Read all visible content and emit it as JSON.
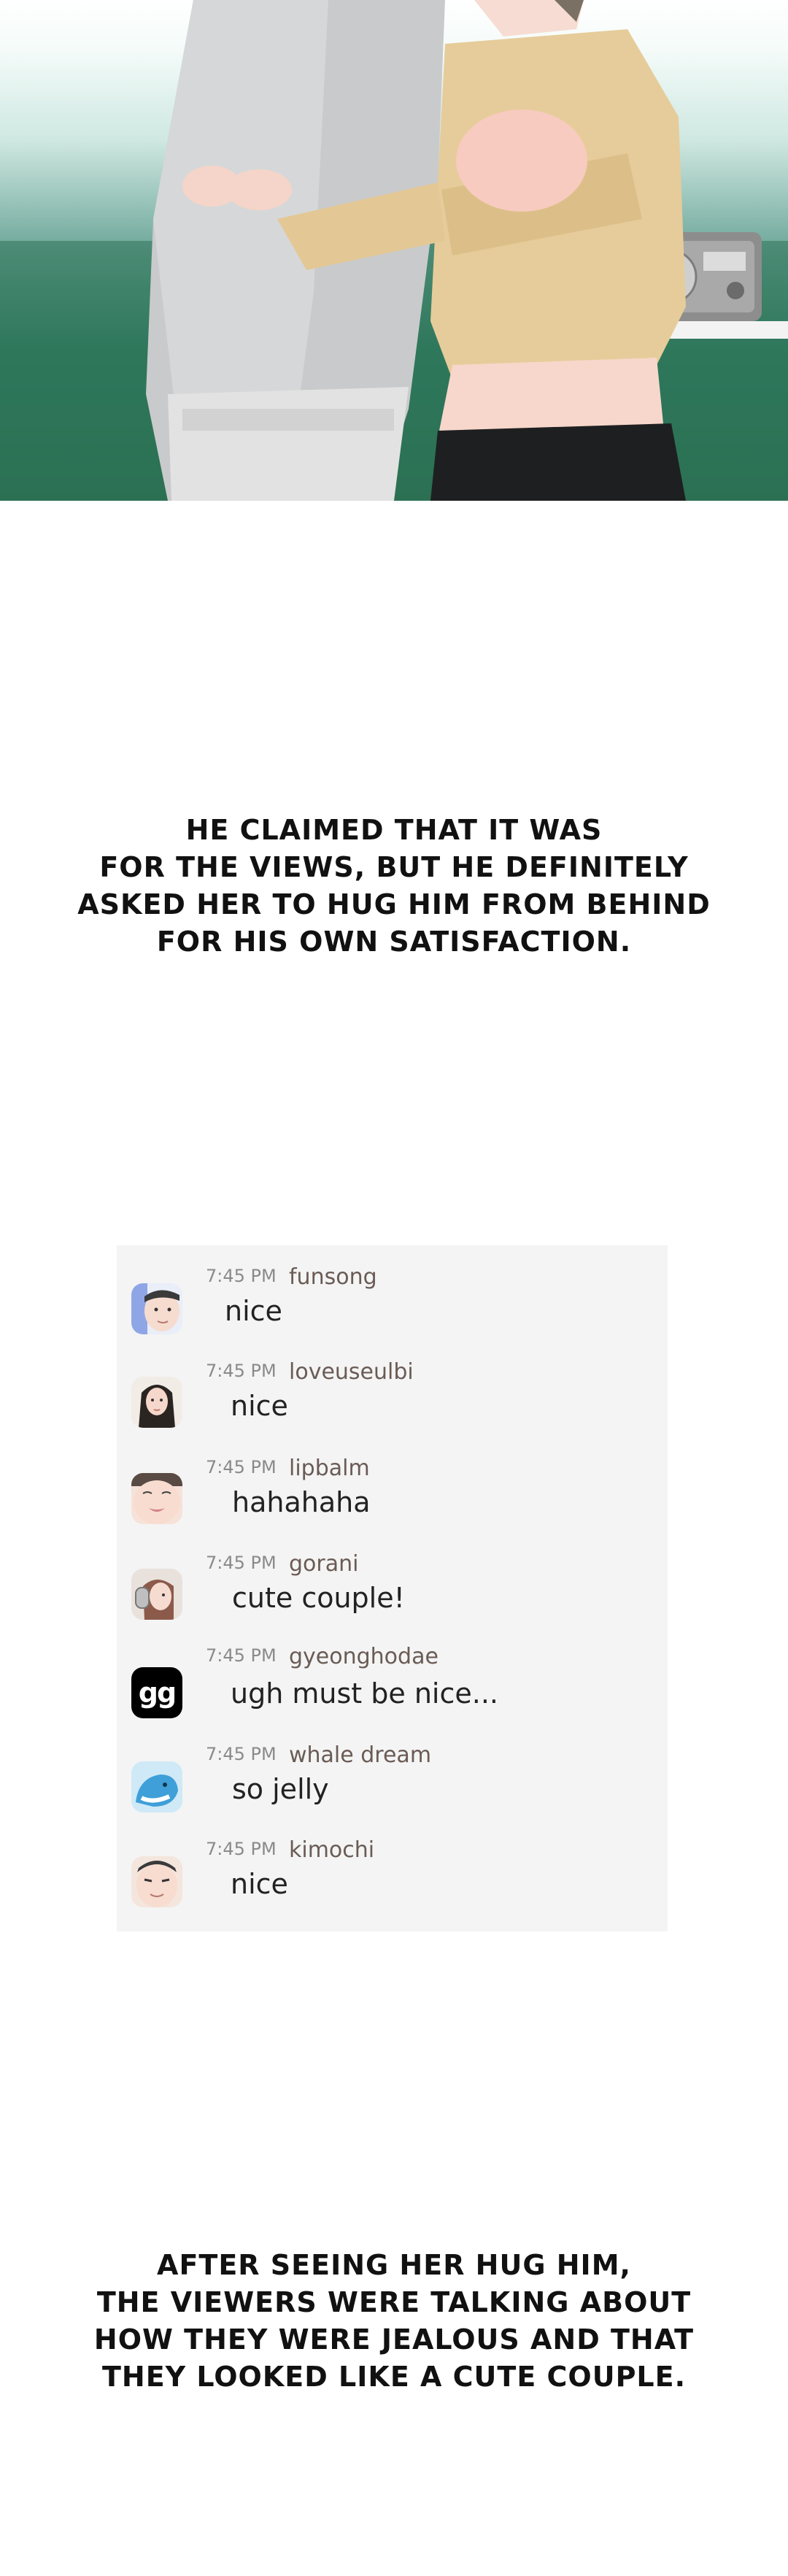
{
  "narration_top": [
    "He claimed that it was",
    "for the views, but he definitely",
    "asked her to hug him from behind",
    "for his own satisfaction."
  ],
  "chat": {
    "messages": [
      {
        "time": "7:45 PM",
        "user": "funsong",
        "text": "nice",
        "avatar": "man-face-avatar"
      },
      {
        "time": "7:45 PM",
        "user": "loveuseulbi",
        "text": "nice",
        "avatar": "woman-long-hair-avatar"
      },
      {
        "time": "7:45 PM",
        "user": "lipbalm",
        "text": "hahahaha",
        "avatar": "woman-lips-avatar"
      },
      {
        "time": "7:45 PM",
        "user": "gorani",
        "text": "cute couple!",
        "avatar": "headphones-girl-avatar"
      },
      {
        "time": "7:45 PM",
        "user": "gyeonghodae",
        "text": "ugh must be nice...",
        "avatar": "gg-logo-avatar",
        "avatar_text": "gg"
      },
      {
        "time": "7:45 PM",
        "user": "whale dream",
        "text": "so jelly",
        "avatar": "whale-avatar"
      },
      {
        "time": "7:45 PM",
        "user": "kimochi",
        "text": "nice",
        "avatar": "man-face-avatar"
      }
    ]
  },
  "narration_bottom": [
    "After seeing her hug him,",
    "the viewers were talking about",
    "how they were jealous and that",
    "they looked like a cute couple."
  ],
  "colors": {
    "chat_background": "#f4f4f4",
    "username": "#6a5b55",
    "timestamp": "#8a8a8a",
    "panel_green": "#2f7d63"
  }
}
